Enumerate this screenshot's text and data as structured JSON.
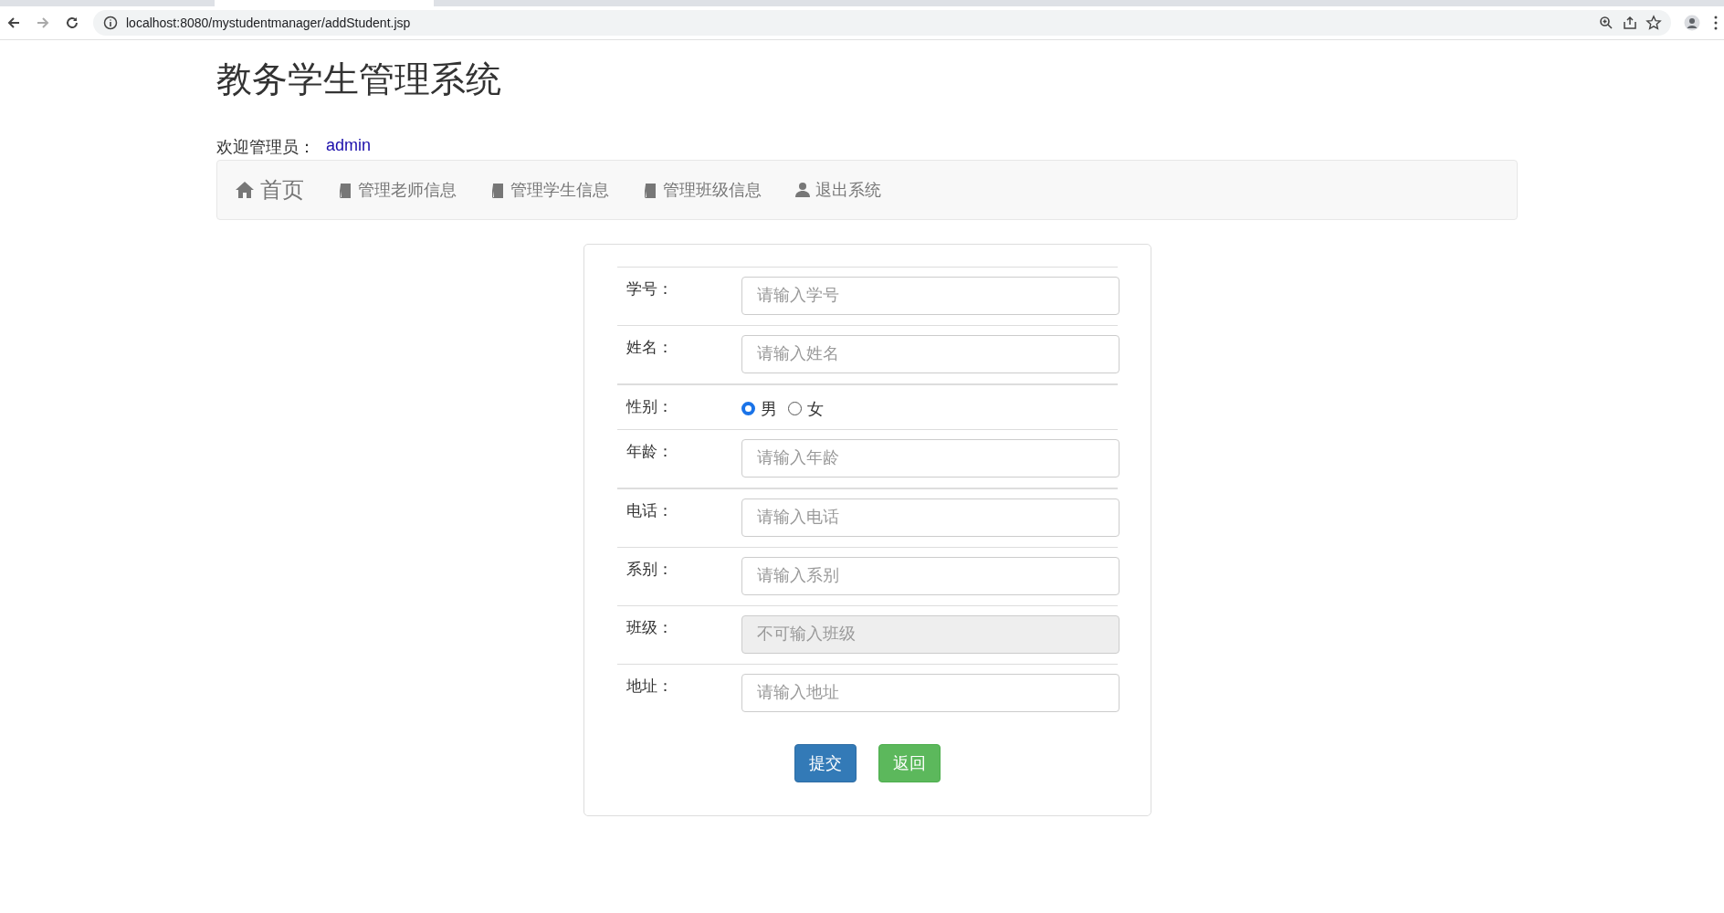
{
  "browser": {
    "url": "localhost:8080/mystudentmanager/addStudent.jsp"
  },
  "page_title": "教务学生管理系统",
  "welcome": {
    "label": "欢迎管理员：",
    "user": "admin"
  },
  "nav": [
    {
      "kind": "home",
      "label": "首页"
    },
    {
      "kind": "book",
      "label": "管理老师信息"
    },
    {
      "kind": "book",
      "label": "管理学生信息"
    },
    {
      "kind": "book",
      "label": "管理班级信息"
    },
    {
      "kind": "user",
      "label": "退出系统"
    }
  ],
  "form": {
    "rows": [
      {
        "kind": "text",
        "label": "学号：",
        "placeholder": "请输入学号"
      },
      {
        "kind": "text",
        "label": "姓名：",
        "placeholder": "请输入姓名"
      },
      {
        "kind": "radio",
        "label": "性别：",
        "options": [
          {
            "label": "男",
            "selected": true
          },
          {
            "label": "女",
            "selected": false
          }
        ]
      },
      {
        "kind": "text",
        "label": "年龄：",
        "placeholder": "请输入年龄"
      },
      {
        "kind": "text",
        "label": "电话：",
        "placeholder": "请输入电话"
      },
      {
        "kind": "text",
        "label": "系别：",
        "placeholder": "请输入系别"
      },
      {
        "kind": "disabled",
        "label": "班级：",
        "placeholder": "不可输入班级"
      },
      {
        "kind": "text",
        "label": "地址：",
        "placeholder": "请输入地址"
      }
    ],
    "buttons": [
      {
        "kind": "primary",
        "label": "提交"
      },
      {
        "kind": "success",
        "label": "返回"
      }
    ]
  }
}
